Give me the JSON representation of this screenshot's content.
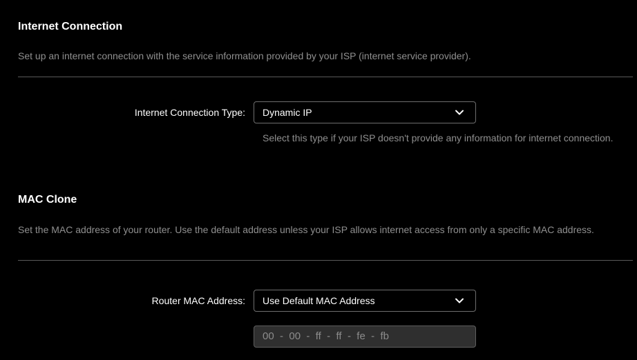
{
  "internet_connection": {
    "title": "Internet Connection",
    "description": "Set up an internet connection with the service information provided by your ISP (internet service provider).",
    "type_label": "Internet Connection Type:",
    "type_value": "Dynamic IP",
    "type_hint": "Select this type if your ISP doesn't provide any information for internet connection."
  },
  "mac_clone": {
    "title": "MAC Clone",
    "description": "Set the MAC address of your router. Use the default address unless your ISP allows internet access from only a specific MAC address.",
    "router_mac_label": "Router MAC Address:",
    "router_mac_value": "Use Default MAC Address",
    "mac_octets": [
      "00",
      "00",
      "ff",
      "ff",
      "fe",
      "fb"
    ],
    "mac_separator": "-"
  },
  "icons": {
    "dropdown": "chevron-down-icon"
  },
  "colors": {
    "background": "#000000",
    "text": "#ffffff",
    "muted": "#8f8f8f",
    "divider": "#5a5a5a",
    "disabled_field": "#2f2f2f"
  }
}
